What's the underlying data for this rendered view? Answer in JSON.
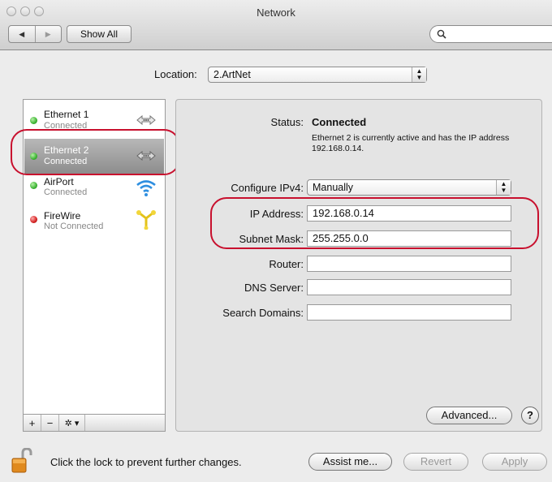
{
  "window": {
    "title": "Network"
  },
  "toolbar": {
    "back_label": "◀",
    "forward_label": "▶",
    "show_all_label": "Show All",
    "search_value": ""
  },
  "location": {
    "label": "Location:",
    "value": "2.ArtNet"
  },
  "services": [
    {
      "name": "Ethernet 1",
      "status": "Connected",
      "state_color": "#3db534",
      "icon": "ethernet-icon"
    },
    {
      "name": "Ethernet 2",
      "status": "Connected",
      "state_color": "#3db534",
      "icon": "ethernet-icon",
      "selected": true
    },
    {
      "name": "AirPort",
      "status": "Connected",
      "state_color": "#3db534",
      "icon": "wifi-icon"
    },
    {
      "name": "FireWire",
      "status": "Not Connected",
      "state_color": "#d42222",
      "icon": "firewire-icon"
    }
  ],
  "sidebar_toolbar": {
    "add": "+",
    "remove": "−",
    "gear": "✲ ▾"
  },
  "detail": {
    "status_label": "Status:",
    "status_value": "Connected",
    "status_desc": "Ethernet 2 is currently active and has the IP address 192.168.0.14.",
    "configure_label": "Configure IPv4:",
    "configure_value": "Manually",
    "ip_label": "IP Address:",
    "ip_value": "192.168.0.14",
    "subnet_label": "Subnet Mask:",
    "subnet_value": "255.255.0.0",
    "router_label": "Router:",
    "router_value": "",
    "dns_label": "DNS Server:",
    "dns_value": "",
    "search_domains_label": "Search Domains:",
    "search_domains_value": "",
    "advanced_label": "Advanced...",
    "help_label": "?"
  },
  "footer": {
    "lock_text": "Click the lock to prevent further changes.",
    "assist_label": "Assist me...",
    "revert_label": "Revert",
    "apply_label": "Apply"
  },
  "colors": {
    "highlight_ring": "#c8102e",
    "connected": "#3db534",
    "not_connected": "#d42222"
  }
}
